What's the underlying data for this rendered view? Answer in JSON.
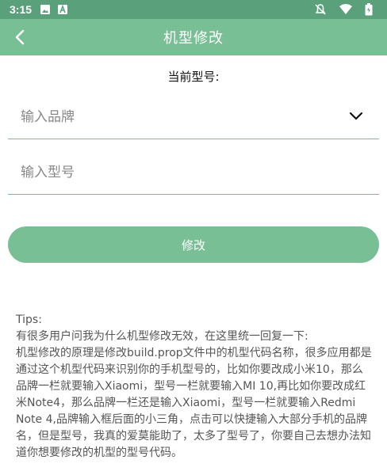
{
  "status_bar": {
    "time": "3:15",
    "left_icons": [
      "image-icon",
      "a-letter-icon"
    ],
    "right_icons": [
      "notifications-off-icon",
      "wifi-icon",
      "battery-icon"
    ]
  },
  "app_bar": {
    "title": "机型修改",
    "back_icon": "back-arrow-icon"
  },
  "current_model_label": "当前型号:",
  "fields": {
    "brand_placeholder": "输入品牌",
    "model_placeholder": "输入型号"
  },
  "submit_label": "修改",
  "tips": {
    "heading": "Tips:",
    "line1": "有很多用户问我为什么机型修改无效，在这里统一回复一下:",
    "body": "机型修改的原理是修改build.prop文件中的机型代码名称，很多应用都是通过这个机型代码来识别你的手机型号的，比如你要改成小米10，那么品牌一栏就要输入Xiaomi，型号一栏就要输入MI 10,再比如你要改成红米Note4，那么品牌一栏还是输入Xiaomi，型号一栏就要输入Redmi Note 4,品牌输入框后面的小三角，点击可以快捷输入大部分手机的品牌名，但是型号，我真的爱莫能助了，太多了型号了，你要自己去想办法知道你想要修改的机型的型号代码。"
  },
  "colors": {
    "status_bar": "#5aa07a",
    "accent": "#79bf96"
  }
}
